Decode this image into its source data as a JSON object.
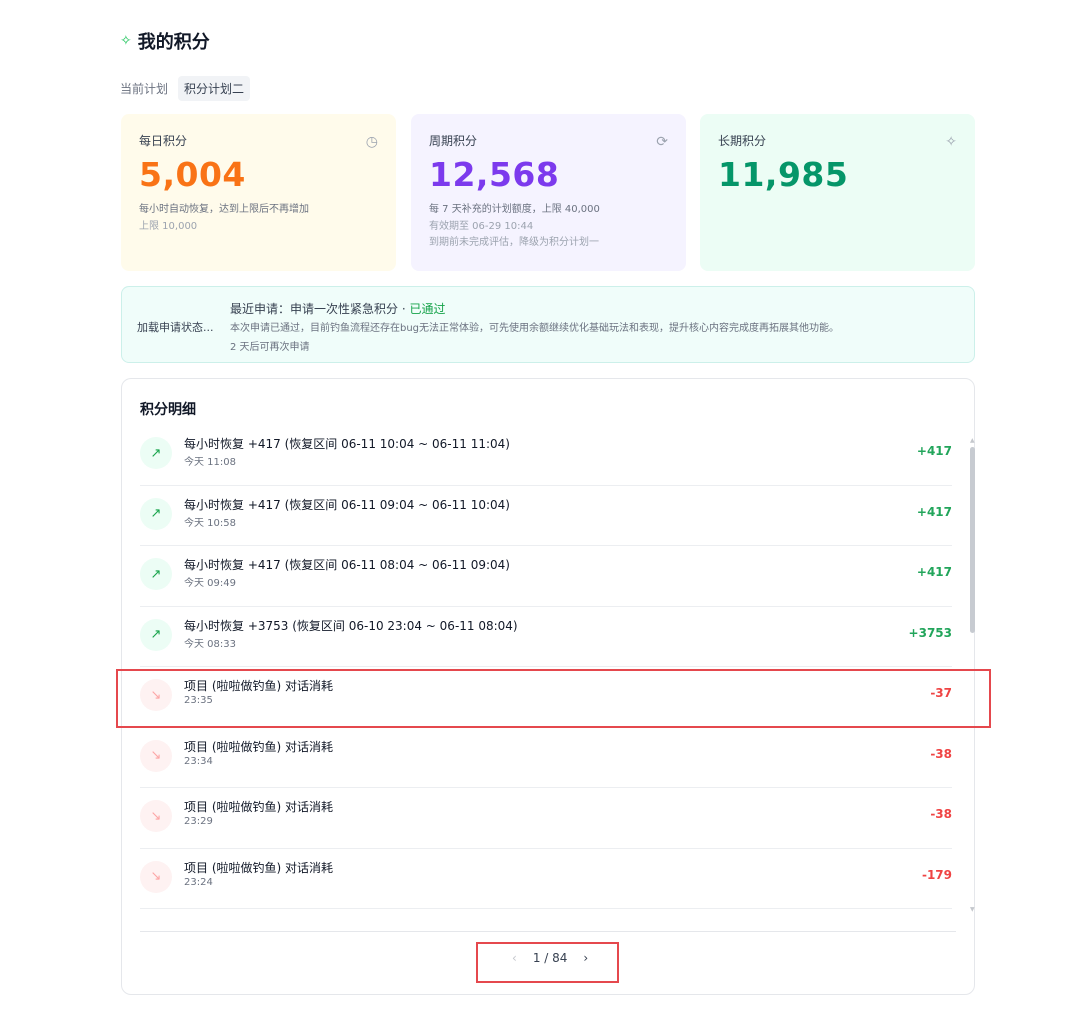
{
  "header": {
    "title": "我的积分",
    "sparkle_icon": "sparkle-icon"
  },
  "plan": {
    "label": "当前计划",
    "value": "积分计划二"
  },
  "cards": {
    "daily": {
      "label": "每日积分",
      "value": "5,004",
      "desc": "每小时自动恢复，达到上限后不再增加",
      "sub1": "上限 10,000",
      "icon": "clock-icon"
    },
    "period": {
      "label": "周期积分",
      "value": "12,568",
      "desc": "每 7 天补充的计划额度，上限 40,000",
      "sub1": "有效期至 06-29 10:44",
      "sub2": "到期前未完成评估，降级为积分计划一",
      "icon": "refresh-icon"
    },
    "long": {
      "label": "长期积分",
      "value": "11,985",
      "icon": "sparkle-icon"
    }
  },
  "notice": {
    "loading": "加载申请状态...",
    "line1": "最近申请：申请一次性紧急积分 · ",
    "status": "已通过",
    "line2": "本次申请已通过，目前钓鱼流程还存在bug无法正常体验，可先使用余额继续优化基础玩法和表现，提升核心内容完成度再拓展其他功能。",
    "line3": "2 天后可再次申请"
  },
  "detail": {
    "title": "积分明细",
    "rows": [
      {
        "type": "up",
        "title": "每小时恢复 +417 (恢复区间 06-11 10:04 ~ 06-11 11:04)",
        "time": "今天 11:08",
        "amount": "+417"
      },
      {
        "type": "up",
        "title": "每小时恢复 +417 (恢复区间 06-11 09:04 ~ 06-11 10:04)",
        "time": "今天 10:58",
        "amount": "+417"
      },
      {
        "type": "up",
        "title": "每小时恢复 +417 (恢复区间 06-11 08:04 ~ 06-11 09:04)",
        "time": "今天 09:49",
        "amount": "+417"
      },
      {
        "type": "up",
        "title": "每小时恢复 +3753 (恢复区间 06-10 23:04 ~ 06-11 08:04)",
        "time": "今天 08:33",
        "amount": "+3753"
      },
      {
        "type": "down",
        "title": "项目 (啦啦做钓鱼) 对话消耗",
        "time": "23:35",
        "amount": "-37"
      },
      {
        "type": "down",
        "title": "项目 (啦啦做钓鱼) 对话消耗",
        "time": "23:34",
        "amount": "-38"
      },
      {
        "type": "down",
        "title": "项目 (啦啦做钓鱼) 对话消耗",
        "time": "23:29",
        "amount": "-38"
      },
      {
        "type": "down",
        "title": "项目 (啦啦做钓鱼) 对话消耗",
        "time": "23:24",
        "amount": "-179"
      }
    ]
  },
  "pagination": {
    "prev": "‹",
    "label": "1 / 84",
    "next": "›"
  },
  "colors": {
    "daily": "#f97316",
    "period": "#7c3aed",
    "long": "#059669",
    "highlight": "#e5484d"
  }
}
